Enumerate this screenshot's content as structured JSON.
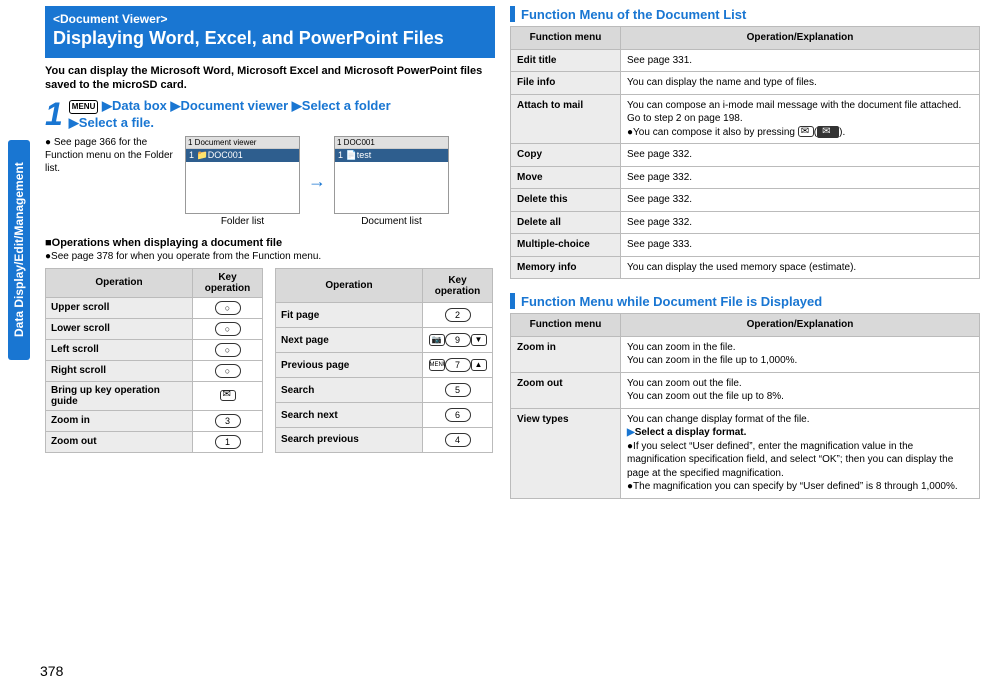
{
  "page_number": "378",
  "side_tab": "Data Display/Edit/Management",
  "title_block": {
    "sub": "<Document Viewer>",
    "main": "Displaying Word, Excel, and PowerPoint Files"
  },
  "intro": "You can display the Microsoft Word, Microsoft Excel and Microsoft PowerPoint files saved to the microSD card.",
  "step": {
    "num": "1",
    "menu_icon": "MENU",
    "parts": [
      "Data box",
      "Document viewer",
      "Select a folder",
      "Select a file."
    ]
  },
  "note_folder": "See page 366 for the Function menu on the Folder list.",
  "screens": {
    "left": {
      "header": "1   Document viewer",
      "row": "DOC001",
      "caption": "Folder list"
    },
    "right": {
      "header": "1           DOC001",
      "row": "test",
      "caption": "Document list"
    }
  },
  "ops_heading": "■Operations when displaying a document file",
  "ops_note": "●See page 378 for when you operate from the Function menu.",
  "op_table_headers": {
    "op": "Operation",
    "key": "Key operation"
  },
  "ops_left": [
    {
      "op": "Upper scroll",
      "key": "○"
    },
    {
      "op": "Lower scroll",
      "key": "○"
    },
    {
      "op": "Left scroll",
      "key": "○"
    },
    {
      "op": "Right scroll",
      "key": "○"
    },
    {
      "op": "Bring up key operation guide",
      "key": "✉"
    },
    {
      "op": "Zoom in",
      "key": "3"
    },
    {
      "op": "Zoom out",
      "key": "1"
    }
  ],
  "ops_right": [
    {
      "op": "Fit page",
      "key": "2"
    },
    {
      "op": "Next page",
      "keys": [
        "📷",
        "9",
        "▼"
      ]
    },
    {
      "op": "Previous page",
      "keys": [
        "MENU",
        "7",
        "▲"
      ]
    },
    {
      "op": "Search",
      "key": "5"
    },
    {
      "op": "Search next",
      "key": "6"
    },
    {
      "op": "Search previous",
      "key": "4"
    }
  ],
  "fm_list": {
    "title": "Function Menu of the Document List",
    "headers": {
      "menu": "Function menu",
      "exp": "Operation/Explanation"
    },
    "rows": [
      {
        "menu": "Edit title",
        "exp": "See page 331."
      },
      {
        "menu": "File info",
        "exp": "You can display the name and type of files."
      },
      {
        "menu": "Attach to mail",
        "exp": "You can compose an i-mode mail message with the document file attached.\nGo to step 2 on page 198.\n●You can compose it also by pressing ✉ ( ✉ )."
      },
      {
        "menu": "Copy",
        "exp": "See page 332."
      },
      {
        "menu": "Move",
        "exp": "See page 332."
      },
      {
        "menu": "Delete this",
        "exp": "See page 332."
      },
      {
        "menu": "Delete all",
        "exp": "See page 332."
      },
      {
        "menu": "Multiple-choice",
        "exp": "See page 333."
      },
      {
        "menu": "Memory info",
        "exp": "You can display the used memory space (estimate)."
      }
    ]
  },
  "fm_disp": {
    "title": "Function Menu while Document File is Displayed",
    "headers": {
      "menu": "Function menu",
      "exp": "Operation/Explanation"
    },
    "rows": [
      {
        "menu": "Zoom in",
        "exp": "You can zoom in the file.\nYou can zoom in the file up to 1,000%."
      },
      {
        "menu": "Zoom out",
        "exp": "You can zoom out the file.\nYou can zoom out the file up to 8%."
      },
      {
        "menu": "View types",
        "exp_head": "You can change display format of the file.",
        "exp_select": "▶Select a display format.",
        "exp_b1": "●If you select “User defined”, enter the magnification value in the magnification specification field, and select “OK”; then you can display the page at the specified magnification.",
        "exp_b2": "●The magnification you can specify by “User defined” is 8 through 1,000%."
      }
    ]
  }
}
